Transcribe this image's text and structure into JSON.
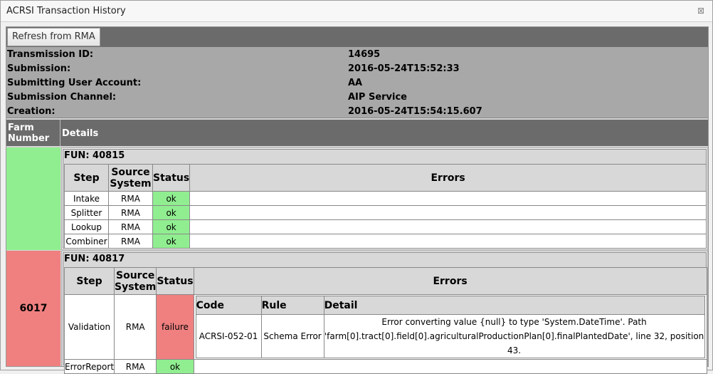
{
  "window": {
    "title": "ACRSI Transaction History",
    "close_glyph": "⊠"
  },
  "toolbar": {
    "refresh_label": "Refresh from RMA"
  },
  "meta": {
    "rows": [
      {
        "label": "Transmission ID:",
        "value": "14695"
      },
      {
        "label": "Submission:",
        "value": "2016-05-24T15:52:33"
      },
      {
        "label": "Submitting User Account:",
        "value": "AA"
      },
      {
        "label": "Submission Channel:",
        "value": "AIP Service"
      },
      {
        "label": "Creation:",
        "value": "2016-05-24T15:54:15.607"
      }
    ]
  },
  "grid": {
    "farm_header_line1": "Farm",
    "farm_header_line2": "Number",
    "details_header": "Details",
    "step_headers": {
      "step": "Step",
      "source1": "Source",
      "source2": "System",
      "status": "Status",
      "errors": "Errors"
    },
    "farms": [
      {
        "farm_number": "",
        "fun_label": "FUN: 40815",
        "color": "#90ee90",
        "steps": [
          {
            "step": "Intake",
            "source": "RMA",
            "status": "ok"
          },
          {
            "step": "Splitter",
            "source": "RMA",
            "status": "ok"
          },
          {
            "step": "Lookup",
            "source": "RMA",
            "status": "ok"
          },
          {
            "step": "Combiner",
            "source": "RMA",
            "status": "ok"
          }
        ]
      },
      {
        "farm_number": "6017",
        "fun_label": "FUN: 40817",
        "color": "#f08080",
        "steps": [
          {
            "step": "Validation",
            "source": "RMA",
            "status": "failure",
            "errors": {
              "headers": {
                "code": "Code",
                "rule": "Rule",
                "detail": "Detail"
              },
              "rows": [
                {
                  "code": "ACRSI-052-01",
                  "rule": "Schema Error",
                  "detail": "Error converting value {null} to type 'System.DateTime'. Path 'farm[0].tract[0].field[0].agriculturalProductionPlan[0].finalPlantedDate', line 32, position 43."
                }
              ]
            }
          },
          {
            "step": "ErrorReport",
            "source": "RMA",
            "status": "ok"
          }
        ]
      }
    ]
  },
  "colors": {
    "ok": "#90ee90",
    "failure": "#f08080",
    "header_dark": "#6b6b6b",
    "meta_bg": "#a8a8a8"
  }
}
